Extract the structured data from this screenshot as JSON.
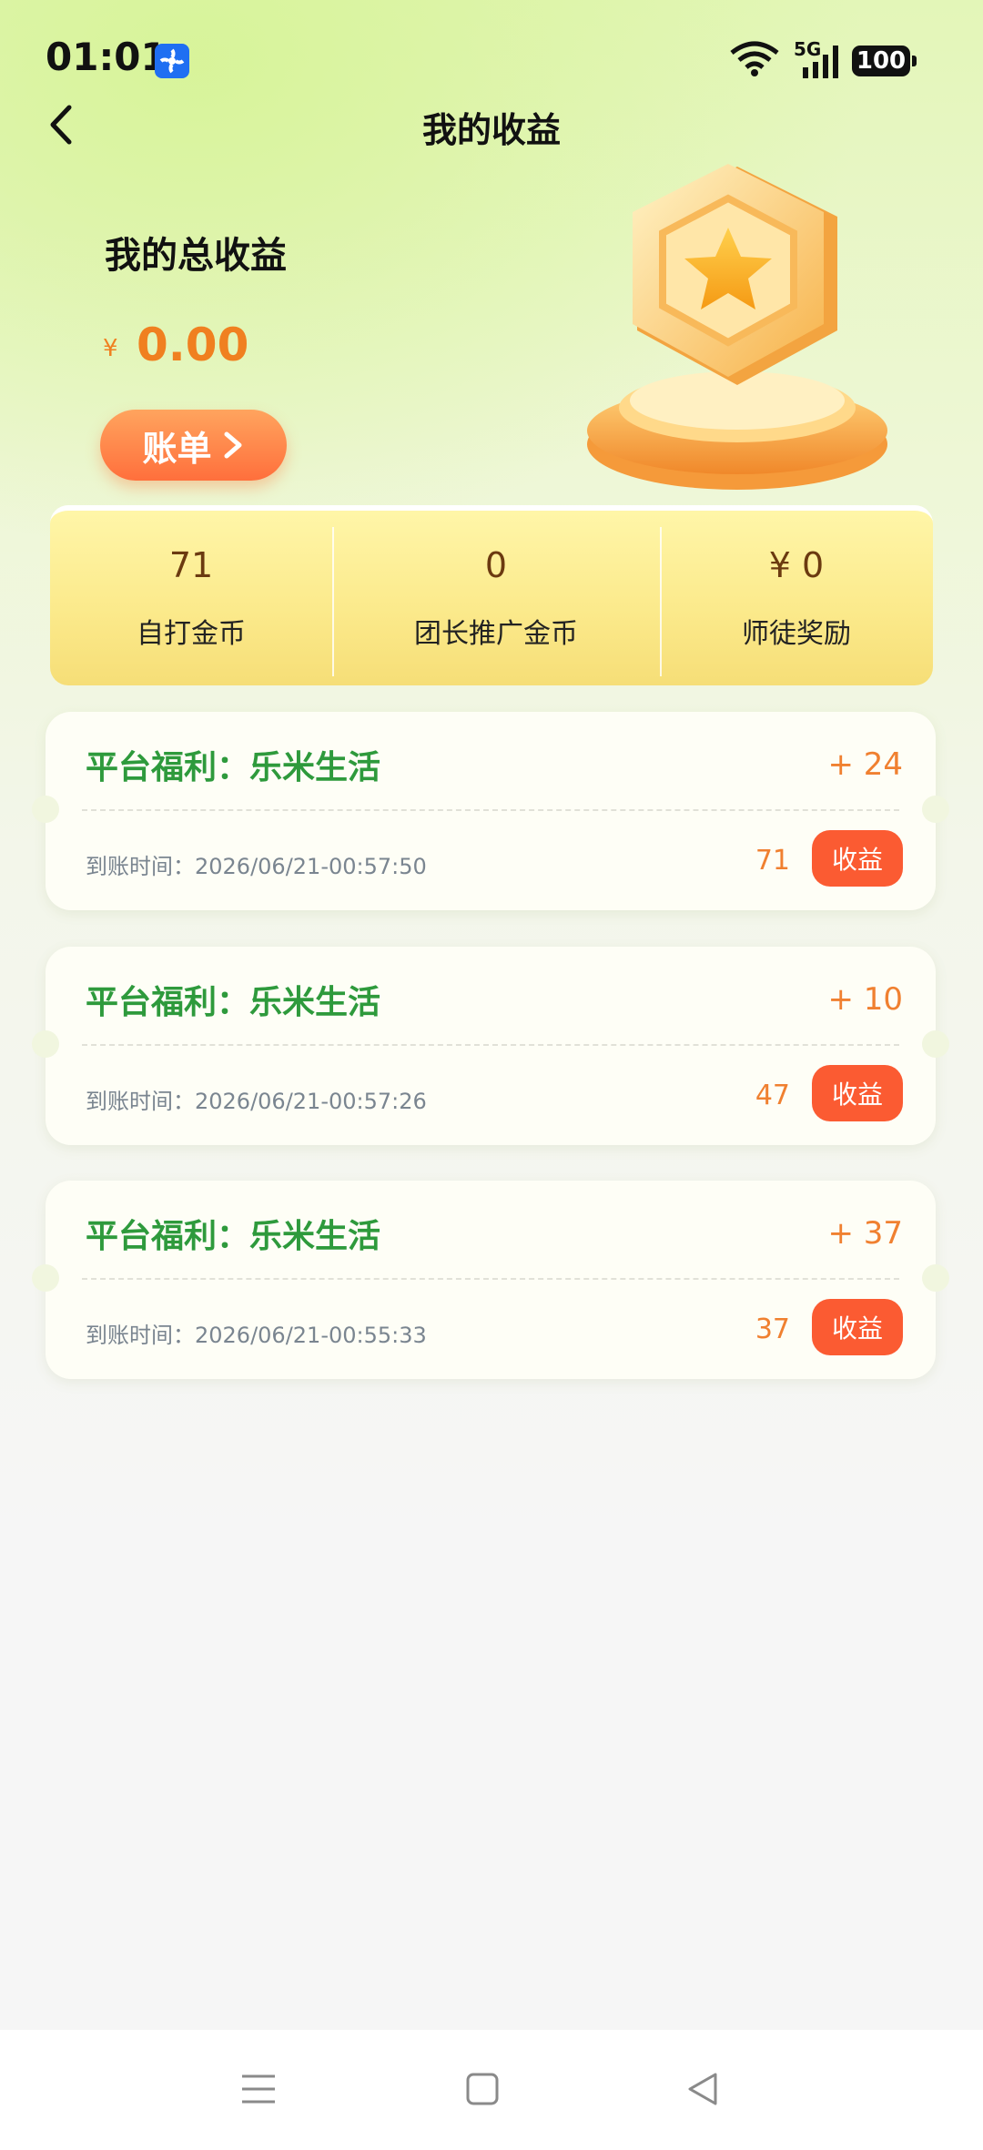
{
  "status": {
    "time": "01:01",
    "network": "5G",
    "battery": "100"
  },
  "header": {
    "title": "我的收益"
  },
  "total": {
    "label": "我的总收益",
    "currency": "¥",
    "amount": "0.00",
    "bill_button": "账单"
  },
  "stats": [
    {
      "value": "71",
      "label": "自打金币"
    },
    {
      "value": "0",
      "label": "团长推广金币"
    },
    {
      "value": "¥ 0",
      "label": "师徒奖励"
    }
  ],
  "records": [
    {
      "title": "平台福利：乐米生活",
      "plus": "+ 24",
      "time": "到账时间：2026/06/21-00:57:50",
      "amount": "71",
      "badge": "收益"
    },
    {
      "title": "平台福利：乐米生活",
      "plus": "+ 10",
      "time": "到账时间：2026/06/21-00:57:26",
      "amount": "47",
      "badge": "收益"
    },
    {
      "title": "平台福利：乐米生活",
      "plus": "+ 37",
      "time": "到账时间：2026/06/21-00:55:33",
      "amount": "37",
      "badge": "收益"
    }
  ],
  "colors": {
    "accent": "#f08020",
    "green": "#2e9a3c",
    "badge": "#fb5b32"
  }
}
